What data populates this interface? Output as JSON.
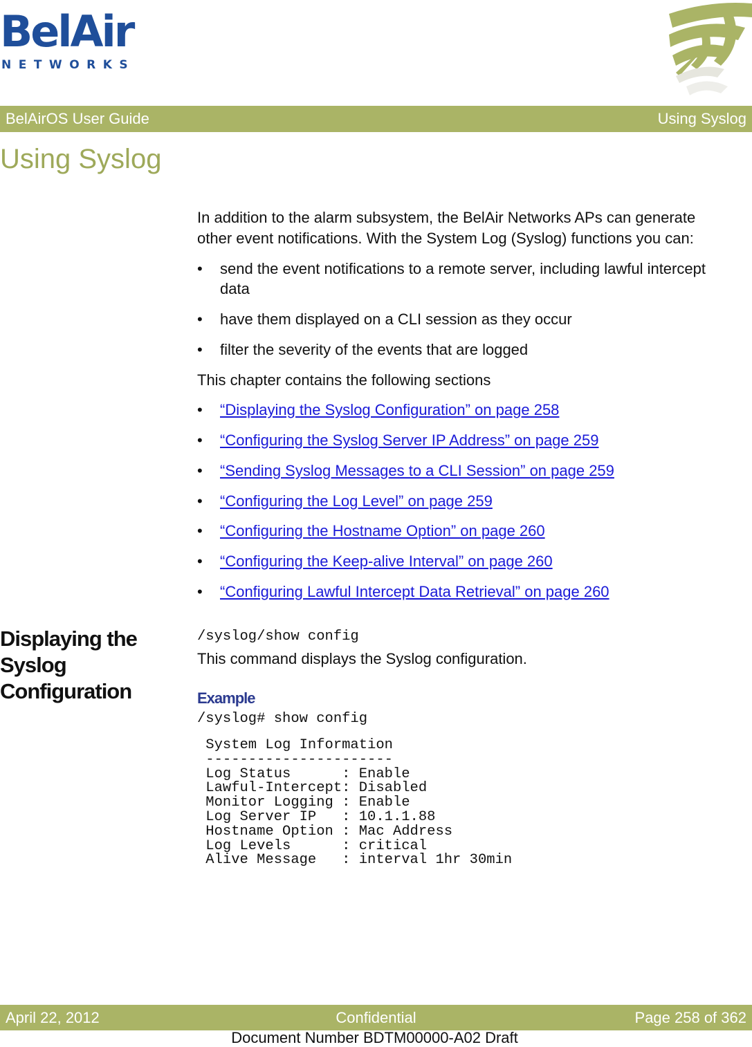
{
  "logo": {
    "word": "BelAir",
    "sub": "NETWORKS"
  },
  "header": {
    "left": "BelAirOS User Guide",
    "right": "Using Syslog"
  },
  "chapter_title": "Using Syslog",
  "intro": {
    "paragraph_line1": "In addition to the alarm subsystem, the BelAir Networks APs can generate",
    "paragraph_line2": "other event notifications. With the System Log (Syslog) functions you can:",
    "bullets": [
      {
        "line1": "send the event notifications to a remote server, including lawful intercept",
        "line2": "data"
      },
      {
        "line1": "have them displayed on a CLI session as they occur"
      },
      {
        "line1": "filter the severity of the events that are logged"
      }
    ],
    "sections_heading": "This chapter contains the following sections"
  },
  "bullet_glyph": "•",
  "toc_links": [
    "“Displaying the Syslog Configuration” on page 258",
    "“Configuring the Syslog Server IP Address” on page 259",
    "“Sending Syslog Messages to a CLI Session” on page 259",
    "“Configuring the Log Level” on page 259",
    "“Configuring the Hostname Option” on page 260",
    "“Configuring the Keep-alive Interval” on page 260",
    "“Configuring Lawful Intercept Data Retrieval” on page 260"
  ],
  "section": {
    "heading_lines": [
      "Displaying the",
      "Syslog",
      "Configuration"
    ],
    "command": "/syslog/show config",
    "description": "This command displays the Syslog configuration.",
    "example_label": "Example",
    "example_command": "/syslog# show config",
    "cli_output": " System Log Information\n ----------------------\n Log Status      : Enable\n Lawful-Intercept: Disabled\n Monitor Logging : Enable\n Log Server IP   : 10.1.1.88\n Hostname Option : Mac Address\n Log Levels      : critical\n Alive Message   : interval 1hr 30min"
  },
  "footer": {
    "date": "April 22, 2012",
    "classification": "Confidential",
    "page": "Page 258 of 362",
    "doc_number": "Document Number BDTM00000-A02 Draft"
  }
}
